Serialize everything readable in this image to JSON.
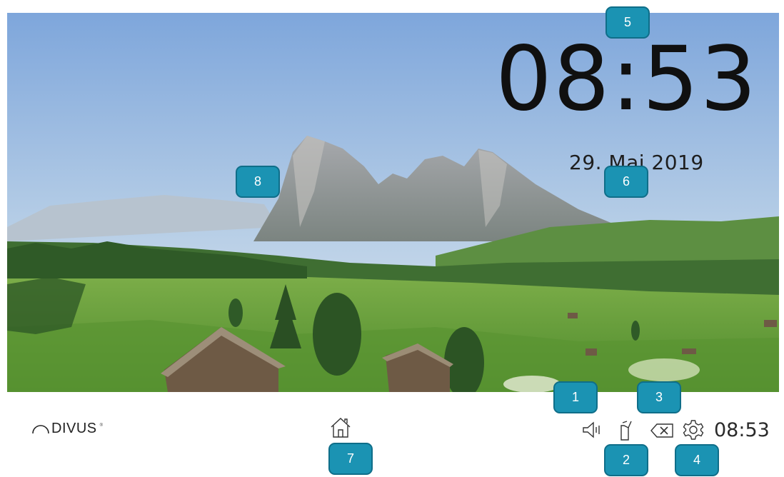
{
  "screen": {
    "time": "08:53",
    "date": "29. Mai 2019"
  },
  "taskbar": {
    "brand": "DIVUS",
    "brand_mark": "®",
    "time": "08:53"
  },
  "icons": {
    "home": "home-icon",
    "volume": "volume-icon",
    "intercom": "intercom-handset-icon",
    "clear": "clear-icon",
    "settings": "gear-icon"
  },
  "badges": {
    "b1": "1",
    "b2": "2",
    "b3": "3",
    "b4": "4",
    "b5": "5",
    "b6": "6",
    "b7": "7",
    "b8": "8"
  },
  "colors": {
    "badge": "#1b93b3",
    "sky": "#9cbbe0",
    "meadow": "#6da842"
  }
}
